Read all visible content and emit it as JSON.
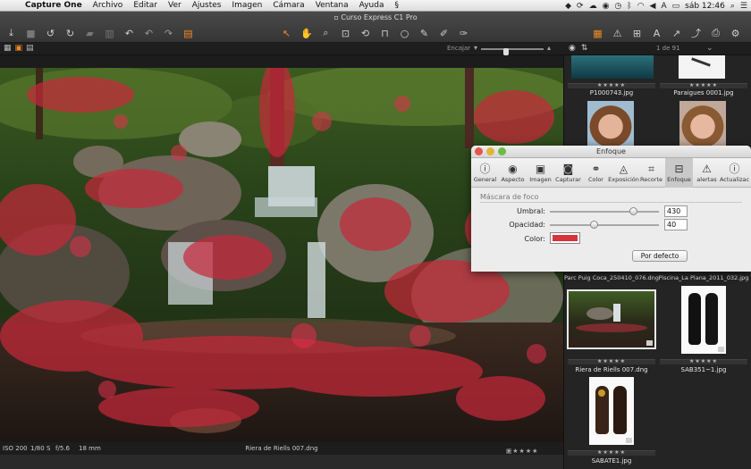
{
  "menubar": {
    "app": "Capture One",
    "items": [
      "Archivo",
      "Editar",
      "Ver",
      "Ajustes",
      "Imagen",
      "Cámara",
      "Ventana",
      "Ayuda"
    ],
    "clock": "sáb 12:46"
  },
  "window": {
    "title": "Curso Express C1 Pro"
  },
  "strip": {
    "fit_label": "Encajar",
    "page_counter": "1 de 91"
  },
  "viewer": {
    "iso": "ISO 200",
    "shutter": "1/80 S",
    "aperture": "f/5.6",
    "focal": "18 mm",
    "filename": "Riera de Riells 007.dng",
    "stars": "★★★★★",
    "zoom_fraction": 0.35
  },
  "browser": {
    "stars": "★★★★★",
    "thumbs": [
      {
        "caption": "P1000743.jpg"
      },
      {
        "caption": "Paraigues 0001.jpg"
      },
      {
        "caption": "Parc Puig Coca_250410_076.dng"
      },
      {
        "caption": "Piscina_La Plana_2011_032.jpg"
      },
      {
        "caption": "Riera de Riells 007.dng"
      },
      {
        "caption": "SAB351~1.jpg"
      },
      {
        "caption": "SABATE1.jpg"
      }
    ]
  },
  "panel": {
    "title": "Enfoque",
    "tabs": [
      {
        "label": "General",
        "icon": "info-icon"
      },
      {
        "label": "Aspecto",
        "icon": "eye-icon"
      },
      {
        "label": "Imagen",
        "icon": "image-icon"
      },
      {
        "label": "Capturar",
        "icon": "camera-icon"
      },
      {
        "label": "Color",
        "icon": "color-icon"
      },
      {
        "label": "Exposición",
        "icon": "exposure-icon"
      },
      {
        "label": "Recorte",
        "icon": "crop-icon"
      },
      {
        "label": "Enfoque",
        "icon": "focus-icon"
      },
      {
        "label": "alertas",
        "icon": "warning-icon"
      },
      {
        "label": "Actualizac",
        "icon": "update-icon"
      }
    ],
    "active_tab": "Enfoque",
    "section": "Máscara de foco",
    "umbral_label": "Umbral:",
    "umbral_value": "430",
    "umbral_fraction": 0.76,
    "opacidad_label": "Opacidad:",
    "opacidad_value": "40",
    "opacidad_fraction": 0.4,
    "color_label": "Color:",
    "mask_color": "#d6343c",
    "reset_label": "Por defecto"
  },
  "colors": {
    "accent": "#f08a24",
    "mask": "#c8283a"
  }
}
